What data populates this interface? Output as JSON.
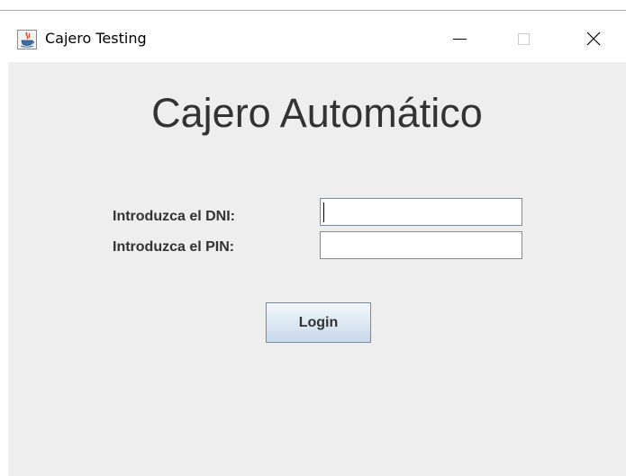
{
  "window": {
    "title": "Cajero Testing",
    "icon": "java-cup-icon",
    "controls": {
      "minimize": "minimize-icon",
      "maximize": "maximize-icon",
      "close": "close-icon"
    }
  },
  "form": {
    "heading": "Cajero Automático",
    "dni_label": "Introduzca el DNI:",
    "dni_value": "",
    "pin_label": "Introduzca el PIN:",
    "pin_value": "",
    "login_label": "Login"
  },
  "colors": {
    "panel_background": "#eeeeee",
    "text": "#333333",
    "field_border": "#7a8a99",
    "button_gradient_top": "#f4f8fc",
    "button_gradient_bottom": "#c8d9ea"
  }
}
